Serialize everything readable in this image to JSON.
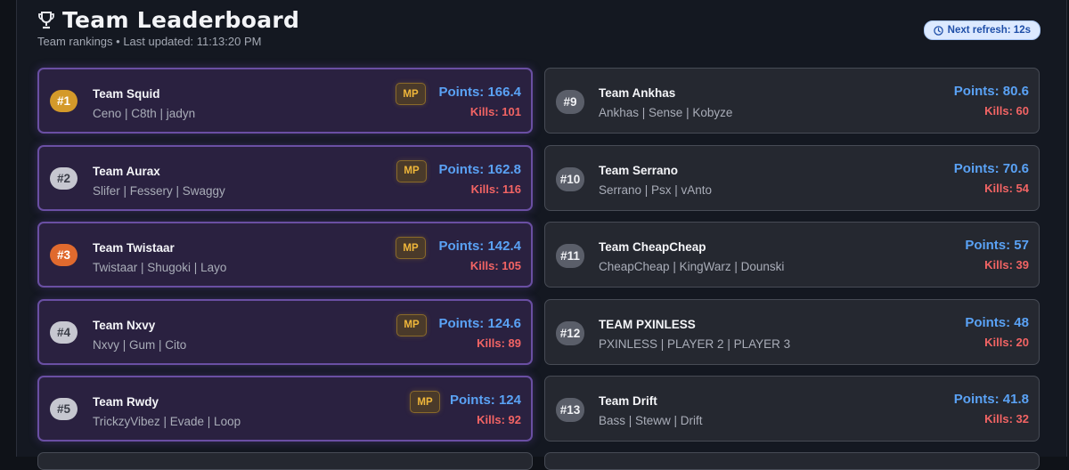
{
  "header": {
    "title": "Team Leaderboard",
    "subtitle": "Team rankings • Last updated: 11:13:20 PM",
    "refresh_label": "Next refresh: 12s",
    "icon": "trophy-icon"
  },
  "colors": {
    "points": "#5aa2f5",
    "kills": "#f26464",
    "mp_badge": "#f0b73a",
    "top_card_border": "#6a4fa3"
  },
  "left_teams": [
    {
      "rank": "#1",
      "name": "Team Squid",
      "members": "Ceno | C8th | jadyn",
      "badge": "MP",
      "points": "Points: 166.4",
      "kills": "Kills: 101"
    },
    {
      "rank": "#2",
      "name": "Team Aurax",
      "members": "Slifer | Fessery | Swaggy",
      "badge": "MP",
      "points": "Points: 162.8",
      "kills": "Kills: 116"
    },
    {
      "rank": "#3",
      "name": "Team Twistaar",
      "members": "Twistaar | Shugoki | Layo",
      "badge": "MP",
      "points": "Points: 142.4",
      "kills": "Kills: 105"
    },
    {
      "rank": "#4",
      "name": "Team Nxvy",
      "members": "Nxvy | Gum | Cito",
      "badge": "MP",
      "points": "Points: 124.6",
      "kills": "Kills: 89"
    },
    {
      "rank": "#5",
      "name": "Team Rwdy",
      "members": "TrickzyVibez | Evade | Loop",
      "badge": "MP",
      "points": "Points: 124",
      "kills": "Kills: 92"
    }
  ],
  "right_teams": [
    {
      "rank": "#9",
      "name": "Team Ankhas",
      "members": "Ankhas | Sense | Kobyze",
      "points": "Points: 80.6",
      "kills": "Kills: 60"
    },
    {
      "rank": "#10",
      "name": "Team Serrano",
      "members": "Serrano | Psx | vAnto",
      "points": "Points: 70.6",
      "kills": "Kills: 54"
    },
    {
      "rank": "#11",
      "name": "Team CheapCheap",
      "members": "CheapCheap | KingWarz | Dounski",
      "points": "Points: 57",
      "kills": "Kills: 39"
    },
    {
      "rank": "#12",
      "name": "TEAM PXINLESS",
      "members": "PXINLESS | PLAYER 2 | PLAYER 3",
      "points": "Points: 48",
      "kills": "Kills: 20"
    },
    {
      "rank": "#13",
      "name": "Team Drift",
      "members": "Bass | Steww | Drift",
      "points": "Points: 41.8",
      "kills": "Kills: 32"
    }
  ]
}
